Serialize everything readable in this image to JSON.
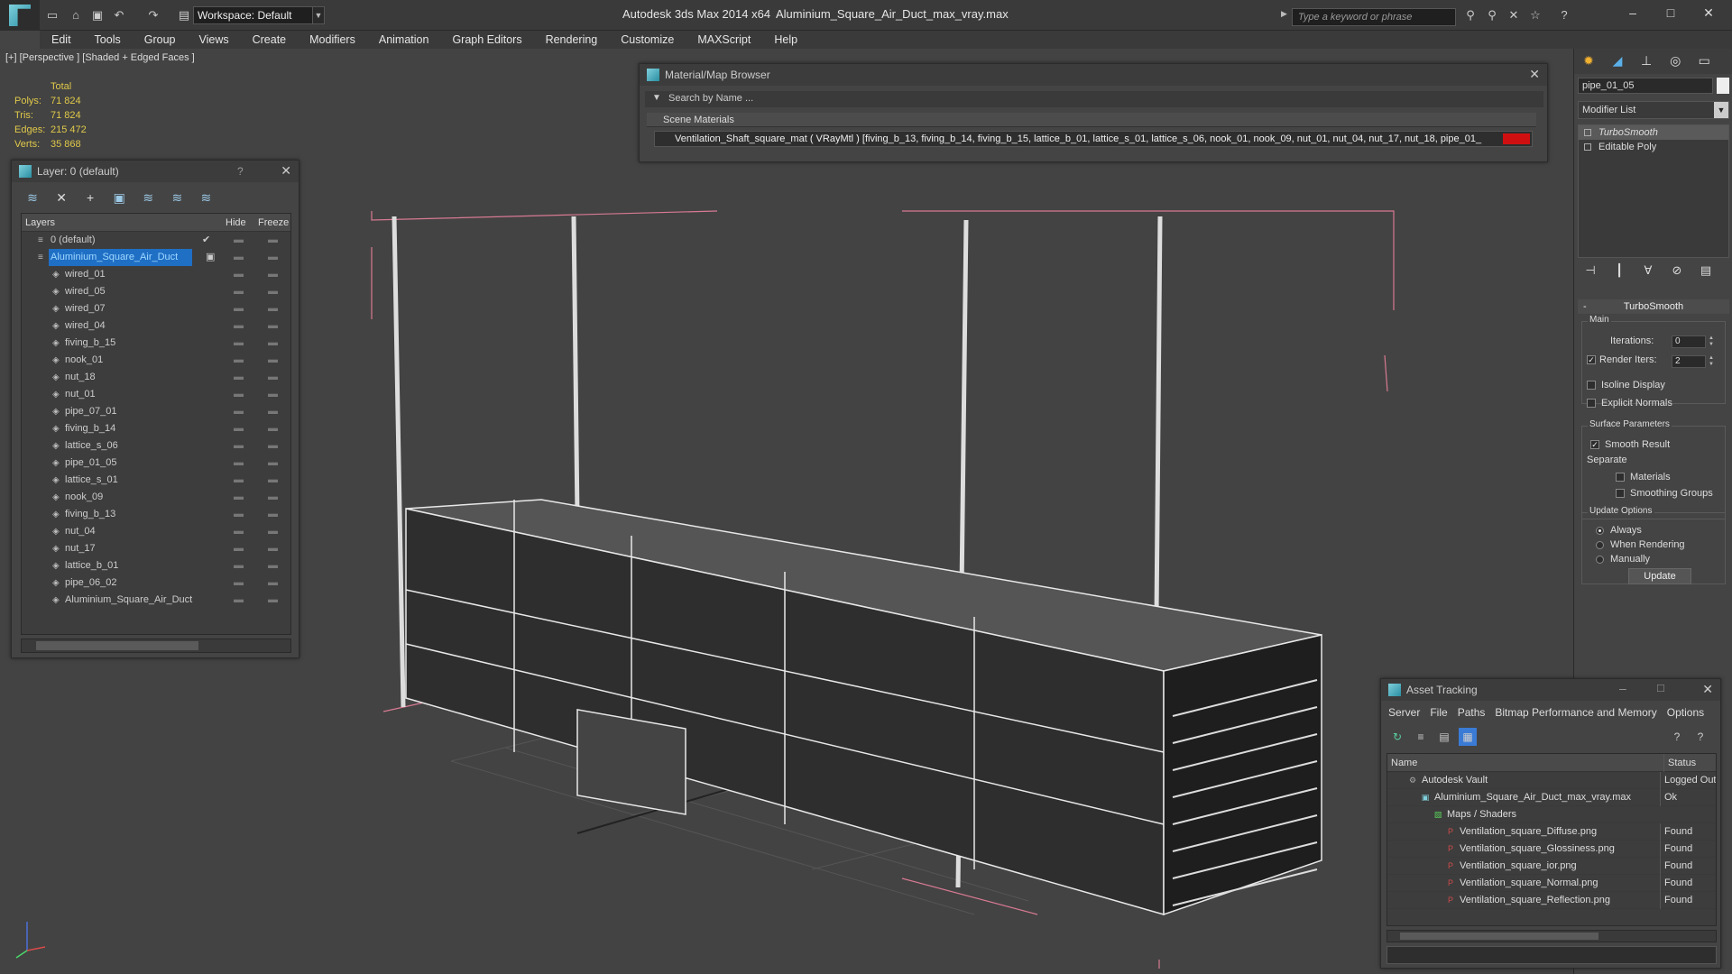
{
  "titlebar": {
    "workspace_label": "Workspace: Default",
    "app_name": "Autodesk 3ds Max  2014 x64",
    "file_name": "Aluminium_Square_Air_Duct_max_vray.max",
    "search_placeholder": "Type a keyword or phrase"
  },
  "menubar": [
    "Edit",
    "Tools",
    "Group",
    "Views",
    "Create",
    "Modifiers",
    "Animation",
    "Graph Editors",
    "Rendering",
    "Customize",
    "MAXScript",
    "Help"
  ],
  "viewport": {
    "label": "[+] [Perspective ] [Shaded + Edged Faces ]",
    "stats": {
      "header": "Total",
      "polys_label": "Polys:",
      "polys": "71 824",
      "tris_label": "Tris:",
      "tris": "71 824",
      "edges_label": "Edges:",
      "edges": "215 472",
      "verts_label": "Verts:",
      "verts": "35 868"
    }
  },
  "layer_panel": {
    "title": "Layer: 0 (default)",
    "help": "?",
    "col_layers": "Layers",
    "col_hide": "Hide",
    "col_freeze": "Freeze",
    "rows": [
      {
        "name": "0 (default)",
        "level": 0,
        "checked": true
      },
      {
        "name": "Aluminium_Square_Air_Duct",
        "level": 0,
        "selected": true
      },
      {
        "name": "wired_01",
        "level": 1
      },
      {
        "name": "wired_05",
        "level": 1
      },
      {
        "name": "wired_07",
        "level": 1
      },
      {
        "name": "wired_04",
        "level": 1
      },
      {
        "name": "fiving_b_15",
        "level": 1
      },
      {
        "name": "nook_01",
        "level": 1
      },
      {
        "name": "nut_18",
        "level": 1
      },
      {
        "name": "nut_01",
        "level": 1
      },
      {
        "name": "pipe_07_01",
        "level": 1
      },
      {
        "name": "fiving_b_14",
        "level": 1
      },
      {
        "name": "lattice_s_06",
        "level": 1
      },
      {
        "name": "pipe_01_05",
        "level": 1
      },
      {
        "name": "lattice_s_01",
        "level": 1
      },
      {
        "name": "nook_09",
        "level": 1
      },
      {
        "name": "fiving_b_13",
        "level": 1
      },
      {
        "name": "nut_04",
        "level": 1
      },
      {
        "name": "nut_17",
        "level": 1
      },
      {
        "name": "lattice_b_01",
        "level": 1
      },
      {
        "name": "pipe_06_02",
        "level": 1
      },
      {
        "name": "Aluminium_Square_Air_Duct",
        "level": 1
      }
    ]
  },
  "material_browser": {
    "title": "Material/Map Browser",
    "search_placeholder": "Search by Name ...",
    "section": "Scene Materials",
    "material_row": "Ventilation_Shaft_square_mat  ( VRayMtl ) [fiving_b_13, fiving_b_14, fiving_b_15, lattice_b_01, lattice_s_01, lattice_s_06, nook_01, nook_09, nut_01, nut_04, nut_17, nut_18, pipe_01_"
  },
  "command_panel": {
    "object_name": "pipe_01_05",
    "modifier_list": "Modifier List",
    "stack": [
      "TurboSmooth",
      "Editable Poly"
    ],
    "turbosmooth": {
      "header": "TurboSmooth",
      "main_label": "Main",
      "iterations_label": "Iterations:",
      "iterations": "0",
      "render_iters_label": "Render Iters:",
      "render_iters": "2",
      "isoline": "Isoline Display",
      "explicit_normals": "Explicit Normals",
      "surface_params": "Surface Parameters",
      "smooth_result": "Smooth Result",
      "separate": "Separate",
      "materials": "Materials",
      "smoothing_groups": "Smoothing Groups",
      "update_options": "Update Options",
      "always": "Always",
      "when_rendering": "When Rendering",
      "manually": "Manually",
      "update_button": "Update"
    }
  },
  "asset_tracking": {
    "title": "Asset Tracking",
    "menu": [
      "Server",
      "File",
      "Paths",
      "Bitmap Performance and Memory",
      "Options"
    ],
    "col_name": "Name",
    "col_status": "Status",
    "rows": [
      {
        "name": "Autodesk Vault",
        "status": "Logged Out",
        "indent": 1,
        "icon": "vault-icon"
      },
      {
        "name": "Aluminium_Square_Air_Duct_max_vray.max",
        "status": "Ok",
        "indent": 2,
        "icon": "max-file-icon"
      },
      {
        "name": "Maps / Shaders",
        "status": "",
        "indent": 3,
        "icon": "maps-icon"
      },
      {
        "name": "Ventilation_square_Diffuse.png",
        "status": "Found",
        "indent": 4,
        "icon": "png-icon"
      },
      {
        "name": "Ventilation_square_Glossiness.png",
        "status": "Found",
        "indent": 4,
        "icon": "png-icon"
      },
      {
        "name": "Ventilation_square_ior.png",
        "status": "Found",
        "indent": 4,
        "icon": "png-icon"
      },
      {
        "name": "Ventilation_square_Normal.png",
        "status": "Found",
        "indent": 4,
        "icon": "png-icon"
      },
      {
        "name": "Ventilation_square_Reflection.png",
        "status": "Found",
        "indent": 4,
        "icon": "png-icon"
      }
    ]
  }
}
